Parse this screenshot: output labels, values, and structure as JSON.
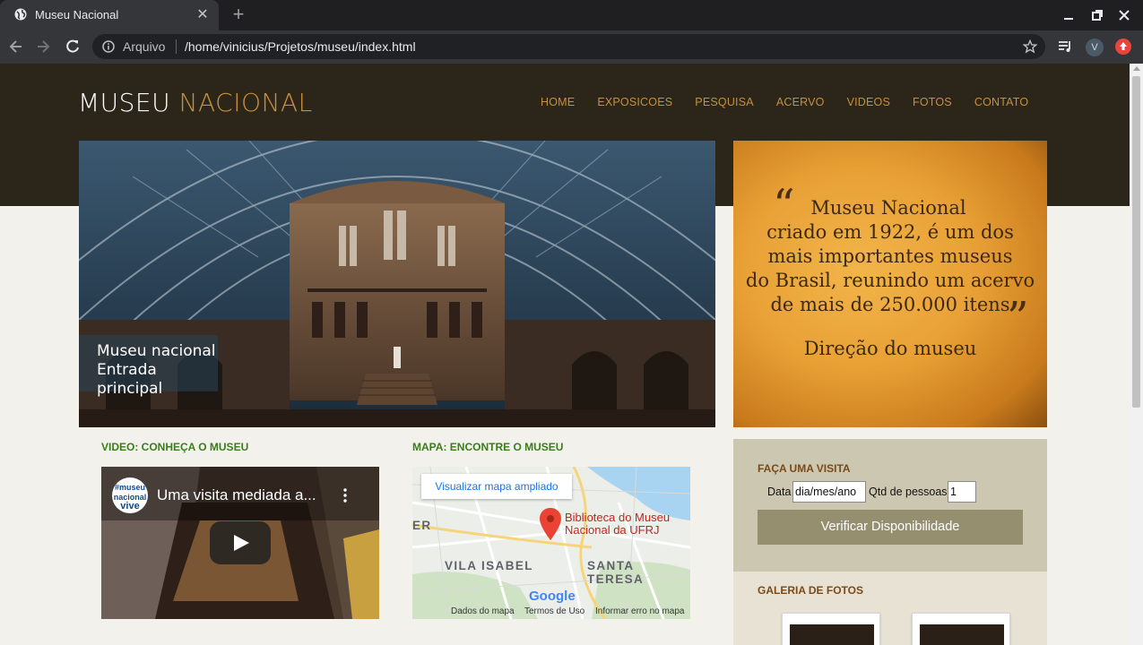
{
  "browser": {
    "tab_title": "Museu Nacional",
    "url_scheme": "Arquivo",
    "url": "/home/vinicius/Projetos/museu/index.html",
    "profile_initial": "V"
  },
  "site": {
    "logo_white": "MUSEU",
    "logo_gold": "NACIONAL",
    "nav": [
      "HOME",
      "EXPOSICOES",
      "PESQUISA",
      "ACERVO",
      "VIDEOS",
      "FOTOS",
      "CONTATO"
    ]
  },
  "hero": {
    "caption_line1": "Museu nacional",
    "caption_line2": "Entrada principal"
  },
  "quote": {
    "lines": [
      "Museu Nacional",
      "criado em 1922, é um dos",
      "mais importantes museus",
      "do Brasil, reunindo um acervo",
      "de mais de 250.000 itens"
    ],
    "open_mark": "“",
    "close_mark": "”",
    "author": "Direção do museu"
  },
  "video": {
    "section_title": "VIDEO: CONHEÇA O MUSEU",
    "title": "Uma visita mediada a...",
    "logo_line1": "#museu",
    "logo_line2": "nacional",
    "logo_line3": "vive"
  },
  "map": {
    "section_title": "MAPA: ENCONTRE O MUSEU",
    "enlarge_link": "Visualizar mapa ampliado",
    "pin_label_line1": "Biblioteca do Museu",
    "pin_label_line2": "Nacional da UFRJ",
    "area_labels": [
      "VILA ISABEL",
      "SANTA TERESA",
      "ER"
    ],
    "google": "Google",
    "footer": [
      "Dados do mapa",
      "Termos de Uso",
      "Informar erro no mapa"
    ]
  },
  "booking": {
    "title": "FAÇA UMA VISITA",
    "date_label": "Data",
    "date_value": "dia/mes/ano",
    "people_label": "Qtd de pessoas",
    "people_value": "1",
    "button": "Verificar Disponibilidade"
  },
  "gallery": {
    "title": "GALERIA DE FOTOS"
  },
  "colors": {
    "header_bg": "#2b251a",
    "accent_gold": "#c8903a",
    "section_green": "#3a7d1a",
    "button": "#958f70"
  }
}
